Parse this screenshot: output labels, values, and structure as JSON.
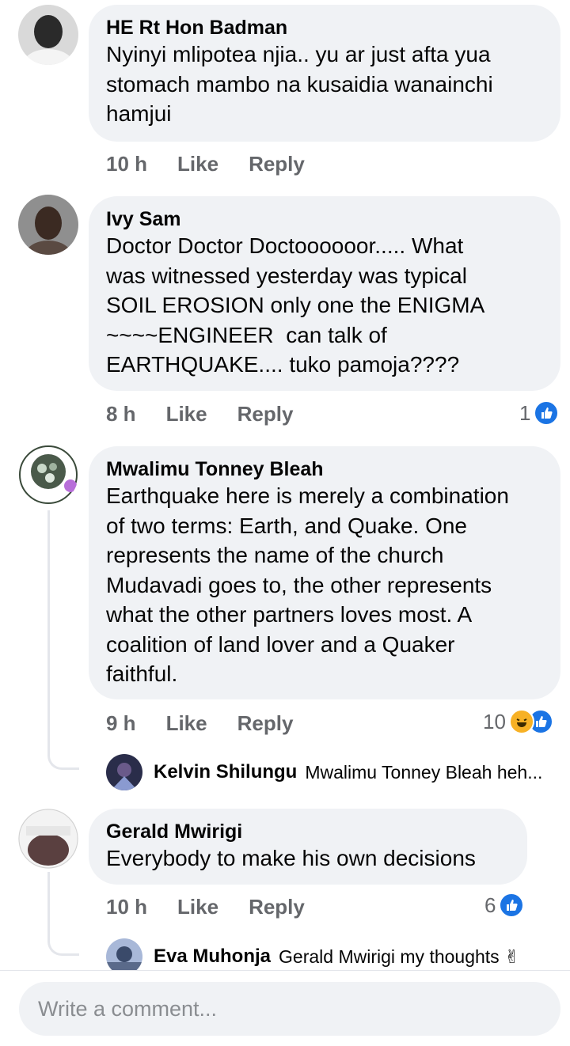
{
  "comments": [
    {
      "author": "HE Rt Hon Badman",
      "text": "Nyinyi mlipotea njia.. yu ar just afta yua\nstomach mambo na kusaidia wanainchi\nhamjui",
      "time": "10 h",
      "like_label": "Like",
      "reply_label": "Reply"
    },
    {
      "author": "Ivy Sam",
      "text": "Doctor Doctor Doctoooooor..... What\nwas witnessed yesterday was typical\nSOIL EROSION only one the ENIGMA\n~~~~ENGINEER  can talk of\nEARTHQUAKE.... tuko pamoja????",
      "time": "8 h",
      "like_label": "Like",
      "reply_label": "Reply",
      "reaction_count": "1"
    },
    {
      "author": "Mwalimu Tonney Bleah",
      "text": "Earthquake here is merely a combination\nof two terms: Earth, and Quake. One\nrepresents the name of the church\nMudavadi goes to, the other represents\nwhat the other partners loves most. A\ncoalition of land lover and a Quaker\nfaithful.",
      "time": "9 h",
      "like_label": "Like",
      "reply_label": "Reply",
      "reaction_count": "10",
      "reply": {
        "author": "Kelvin Shilungu",
        "text": "Mwalimu Tonney Bleah heh..."
      }
    },
    {
      "author": "Gerald Mwirigi",
      "text": "Everybody to make his own decisions",
      "time": "10 h",
      "like_label": "Like",
      "reply_label": "Reply",
      "reaction_count": "6",
      "reply": {
        "author": "Eva Muhonja",
        "text": "Gerald Mwirigi my thoughts ✌"
      }
    }
  ],
  "composer": {
    "placeholder": "Write a comment..."
  },
  "colors": {
    "bubble": "#f0f2f5",
    "meta": "#65676b",
    "like": "#1b74e4",
    "haha": "#f7b125"
  }
}
